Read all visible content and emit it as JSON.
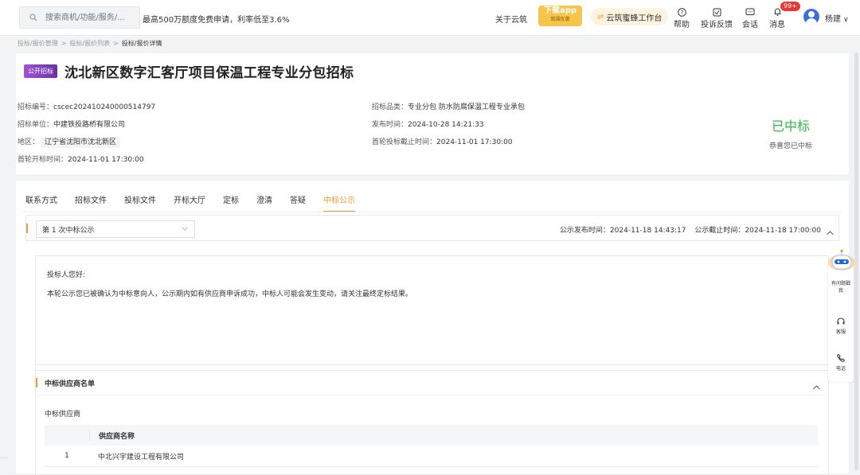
{
  "topbar": {
    "search_placeholder": "搜索商机/功能/服务/...",
    "promo": "最高500万额度免费申请，利率低至3.6%",
    "about": "关于云筑",
    "app_badge": "下载app",
    "app_badge_sub": "筑福优惠",
    "workbench": "云筑蜜蜂工作台",
    "help": "帮助",
    "complaint": "投诉反馈",
    "chat": "会话",
    "messages": "消息",
    "messages_badge": "99+",
    "username": "杨建"
  },
  "breadcrumb": {
    "items": [
      "投标/报价管理",
      "投标/报价列表",
      "投标/报价详情"
    ]
  },
  "tender": {
    "tag": "公开招标",
    "title": "沈北新区数字汇客厅项目保温工程专业分包招标",
    "number_label": "招标编号：",
    "number": "cscec202410240000514797",
    "unit_label": "招标单位：",
    "unit": "中建铁投路桥有限公司",
    "region_label": "地区：",
    "region": "辽宁省沈阳市沈北新区",
    "first_open_label": "首轮开标时间：",
    "first_open": "2024-11-01 17:30:00",
    "category_label": "招标品类：",
    "category": "专业分包 防水防腐保温工程专业承包",
    "publish_label": "发布时间：",
    "publish": "2024-10-28 14:21:33",
    "deadline_label": "首轮投标截止时间：",
    "deadline": "2024-11-01 17:30:00"
  },
  "status": {
    "title": "已中标",
    "subtitle": "恭喜您已中标",
    "color": "#2fb84a"
  },
  "tabs": [
    {
      "label": "联系方式",
      "active": false
    },
    {
      "label": "招标文件",
      "active": false
    },
    {
      "label": "投标文件",
      "active": false
    },
    {
      "label": "开标大厅",
      "active": false
    },
    {
      "label": "定标",
      "active": false
    },
    {
      "label": "澄清",
      "active": false
    },
    {
      "label": "答疑",
      "active": false
    },
    {
      "label": "中标公示",
      "active": true
    }
  ],
  "notice": {
    "round_select": "第 1 次中标公示",
    "publish_label": "公示发布时间：",
    "publish_time": "2024-11-18 14:43:17",
    "end_label": "公示截止时间：",
    "end_time": "2024-11-18 17:00:00",
    "greeting": "投标人您好:",
    "body": "本轮公示您已被确认为中标意向人，公示期内如有供应商申诉成功，中标人可能会发生变动，请关注最终定标结果。"
  },
  "suppliers": {
    "title": "中标供应商名单",
    "subtitle": "中标供应商",
    "col_name": "供应商名称",
    "rows": [
      {
        "index": "1",
        "name": "中北兴宇建设工程有限公司"
      }
    ]
  },
  "rail": {
    "robot_label": "有问题戳我",
    "service": "客服",
    "phone": "电话"
  },
  "colors": {
    "accent": "#f29b2c",
    "tag": "#7b3fb0",
    "success": "#2fb84a"
  }
}
